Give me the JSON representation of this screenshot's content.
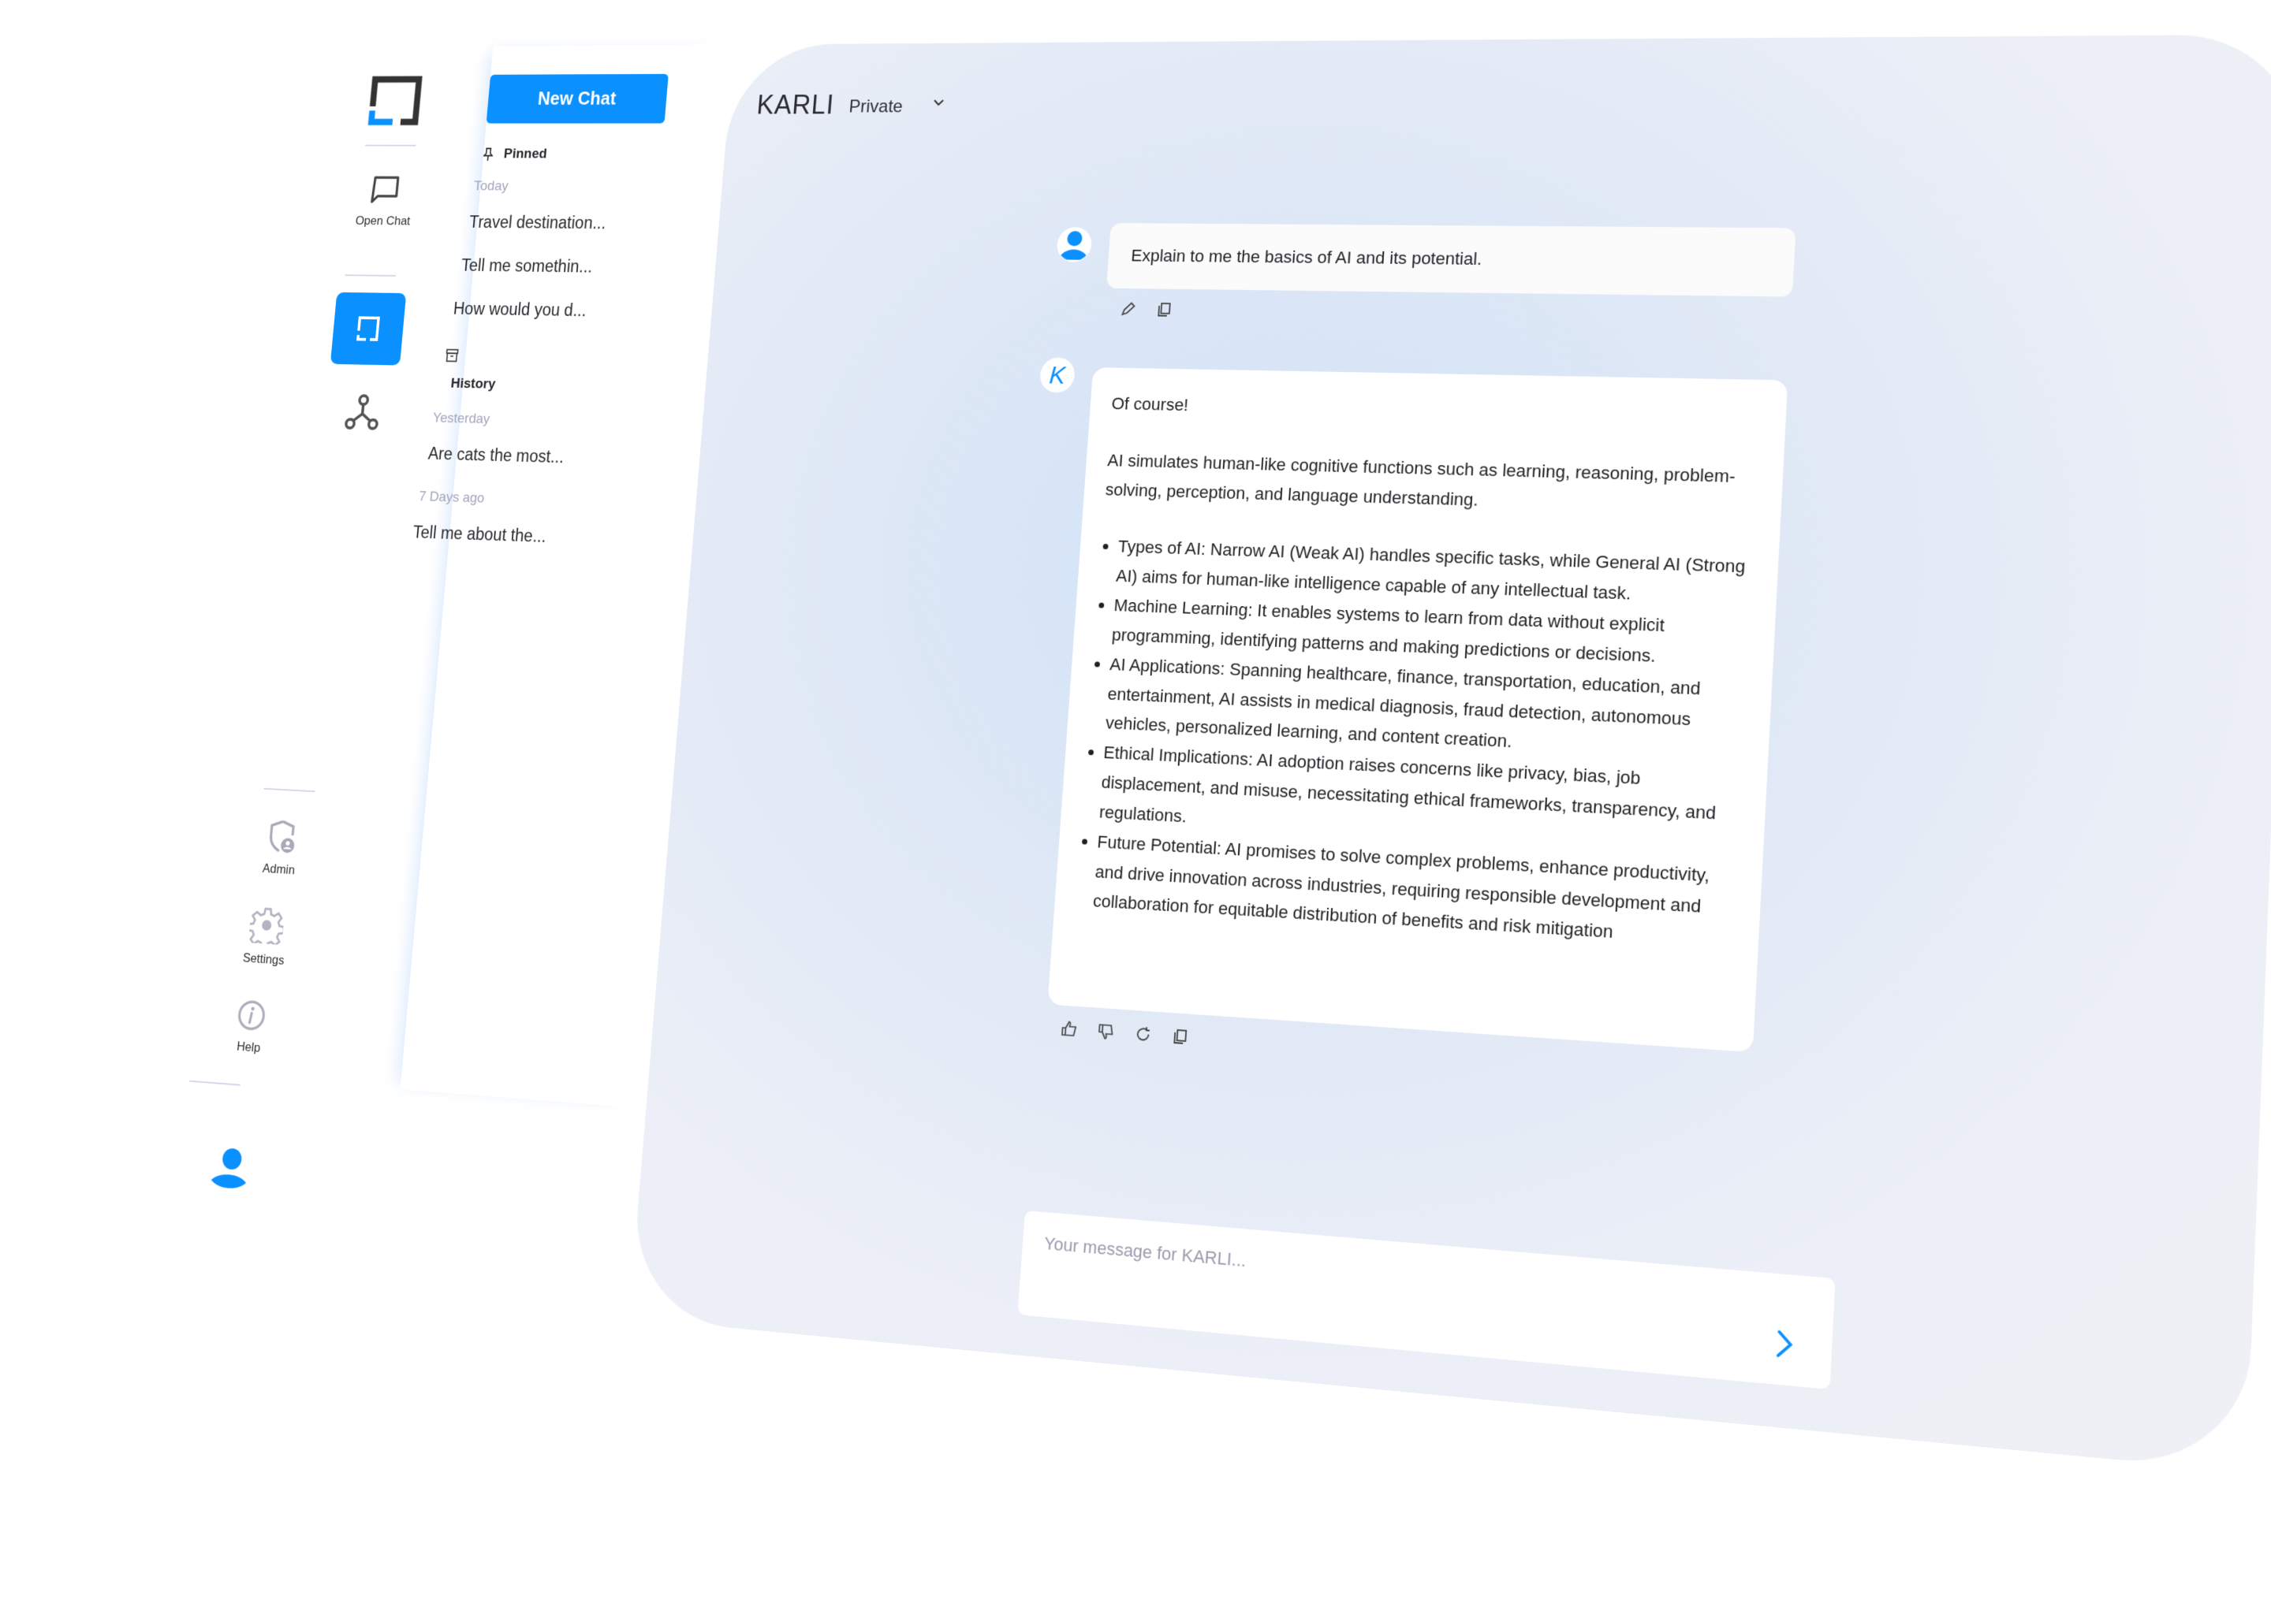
{
  "app": {
    "brand": "KARLI",
    "mode": "Private",
    "accent_color": "#0a90ff"
  },
  "rail": {
    "open_chat_label": "Open Chat",
    "admin_label": "Admin",
    "settings_label": "Settings",
    "help_label": "Help"
  },
  "panel": {
    "new_chat_label": "New Chat",
    "pinned_label": "Pinned",
    "history_label": "History",
    "groups": [
      {
        "label": "Today",
        "items": [
          "Travel destination...",
          "Tell me somethin...",
          "How would you d..."
        ]
      },
      {
        "label": "Yesterday",
        "items": [
          "Are cats the most..."
        ]
      },
      {
        "label": "7 Days ago",
        "items": [
          "Tell me about the..."
        ]
      }
    ]
  },
  "conversation": {
    "user_message": "Explain to me the basics of AI and its potential.",
    "assistant_avatar_letter": "K",
    "assistant_intro": "Of course!",
    "assistant_paragraph": "AI simulates human-like cognitive functions such as learning, reasoning, problem-solving, perception, and language understanding.",
    "assistant_bullets": [
      "Types of AI: Narrow AI (Weak AI) handles specific tasks, while General AI (Strong AI) aims for human-like intelligence capable of any intellectual task.",
      "Machine Learning: It enables systems to learn from data without explicit programming, identifying patterns and making predictions or decisions.",
      "AI Applications: Spanning healthcare, finance, transportation, education, and entertainment, AI assists in medical diagnosis, fraud detection, autonomous vehicles, personalized learning, and content creation.",
      "Ethical Implications: AI adoption raises concerns like privacy, bias, job displacement, and misuse, necessitating ethical frameworks, transparency, and regulations.",
      "Future Potential: AI promises to solve complex problems, enhance productivity, and drive innovation across industries, requiring responsible development and collaboration for equitable distribution of benefits and risk mitigation"
    ]
  },
  "composer": {
    "placeholder": "Your message for KARLI...",
    "value": ""
  }
}
